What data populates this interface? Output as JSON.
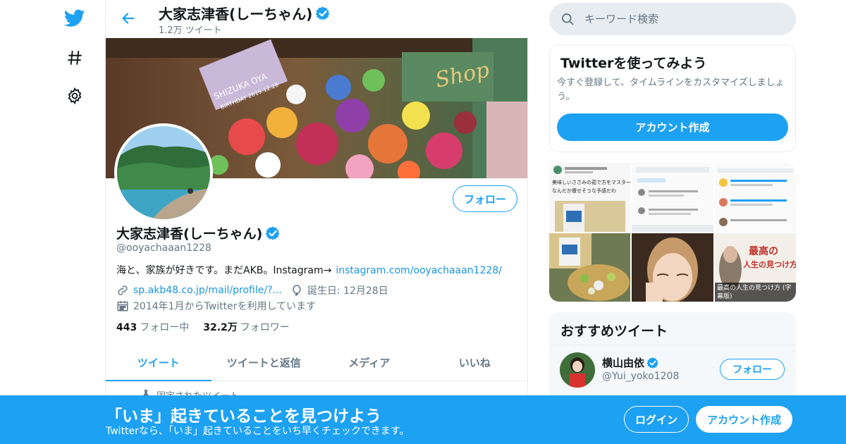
{
  "header": {
    "name": "大家志津香(しーちゃん)",
    "tweet_count": "1.2万 ツイート"
  },
  "profile": {
    "name": "大家志津香(しーちゃん)",
    "handle": "@ooyachaaan1228",
    "bio_text": "海と、家族が好きです。まだAKB。Instagram→",
    "bio_link": "instagram.com/ooyachaaan1228/",
    "website": "sp.akb48.co.jp/mail/profile/?...",
    "birthday": "誕生日: 12月28日",
    "joined": "2014年1月からTwitterを利用しています",
    "following_count": "443",
    "following_label": "フォロー中",
    "followers_count": "32.2万",
    "followers_label": "フォロワー",
    "follow_button": "フォロー",
    "banner_sign": "SHIZUKA OYA",
    "banner_sign_date": "BIRTHDAY 2019.12.28",
    "banner_shop": "Shop"
  },
  "tabs": [
    {
      "label": "ツイート",
      "active": true
    },
    {
      "label": "ツイートと返信",
      "active": false
    },
    {
      "label": "メディア",
      "active": false
    },
    {
      "label": "いいね",
      "active": false
    }
  ],
  "pinned_label": "固定されたツイート",
  "search": {
    "placeholder": "キーワード検索"
  },
  "signup_card": {
    "title": "Twitterを使ってみよう",
    "description": "今すぐ登録して、タイムラインをカスタマイズしましょう。",
    "button": "アカウント作成"
  },
  "media": {
    "tile1_text_1": "美味しいささみの茹で方をマスターした",
    "tile1_text_2": "なんだか痩せそうな予感だわ",
    "tile6_title_1": "最高の",
    "tile6_title_2": "人生の見つけ方",
    "tile6_caption": "最高の人生の見つけ方 (字幕版)"
  },
  "recommended": {
    "title": "おすすめツイート",
    "items": [
      {
        "name": "横山由依",
        "handle": "@Yui_yoko1208",
        "button": "フォロー"
      }
    ]
  },
  "bottom_bar": {
    "title": "「いま」起きていることを見つけよう",
    "subtitle": "Twitterなら、「いま」起きていることをいち早くチェックできます。",
    "login": "ログイン",
    "signup": "アカウント作成"
  },
  "colors": {
    "accent": "#1da1f2",
    "link": "#1b95e0",
    "muted": "#657786",
    "border": "#e6ecf0"
  },
  "icons": {
    "logo": "twitter-bird-icon",
    "explore": "hashtag-icon",
    "settings": "gear-icon",
    "back": "back-arrow-icon",
    "verified": "verified-badge-icon",
    "link": "link-icon",
    "birthday": "balloon-icon",
    "calendar": "calendar-icon",
    "search": "search-icon",
    "pin": "pin-icon"
  }
}
